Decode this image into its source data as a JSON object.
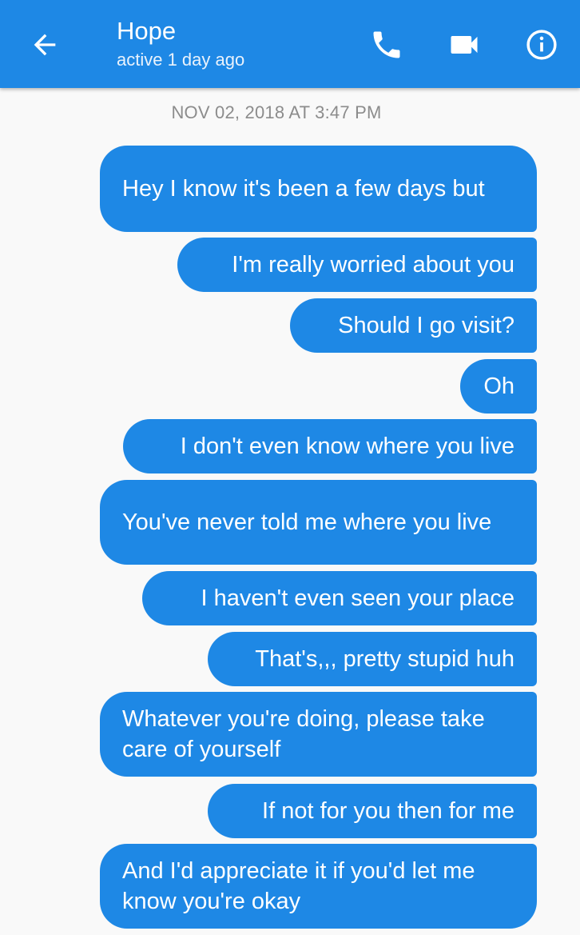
{
  "header": {
    "contact_name": "Hope",
    "status": "active 1 day ago",
    "background_color": "#1e88e5",
    "icons": [
      "back-arrow-icon",
      "phone-icon",
      "video-camera-icon",
      "info-icon"
    ]
  },
  "conversation": {
    "timestamp": "NOV 02, 2018 AT 3:47 PM",
    "bubble_color": "#1e88e5",
    "messages": [
      {
        "sender": "me",
        "text": "Hey I know it's been a few days but"
      },
      {
        "sender": "me",
        "text": "I'm really worried about you"
      },
      {
        "sender": "me",
        "text": "Should I go visit?"
      },
      {
        "sender": "me",
        "text": "Oh"
      },
      {
        "sender": "me",
        "text": "I don't even know where you live"
      },
      {
        "sender": "me",
        "text": "You've never told me where you live"
      },
      {
        "sender": "me",
        "text": "I haven't even seen your place"
      },
      {
        "sender": "me",
        "text": "That's,,, pretty stupid huh"
      },
      {
        "sender": "me",
        "text": "Whatever you're doing, please take care of yourself"
      },
      {
        "sender": "me",
        "text": "If not for you then for me"
      },
      {
        "sender": "me",
        "text": "And I'd appreciate it if you'd let me know you're okay"
      }
    ]
  }
}
